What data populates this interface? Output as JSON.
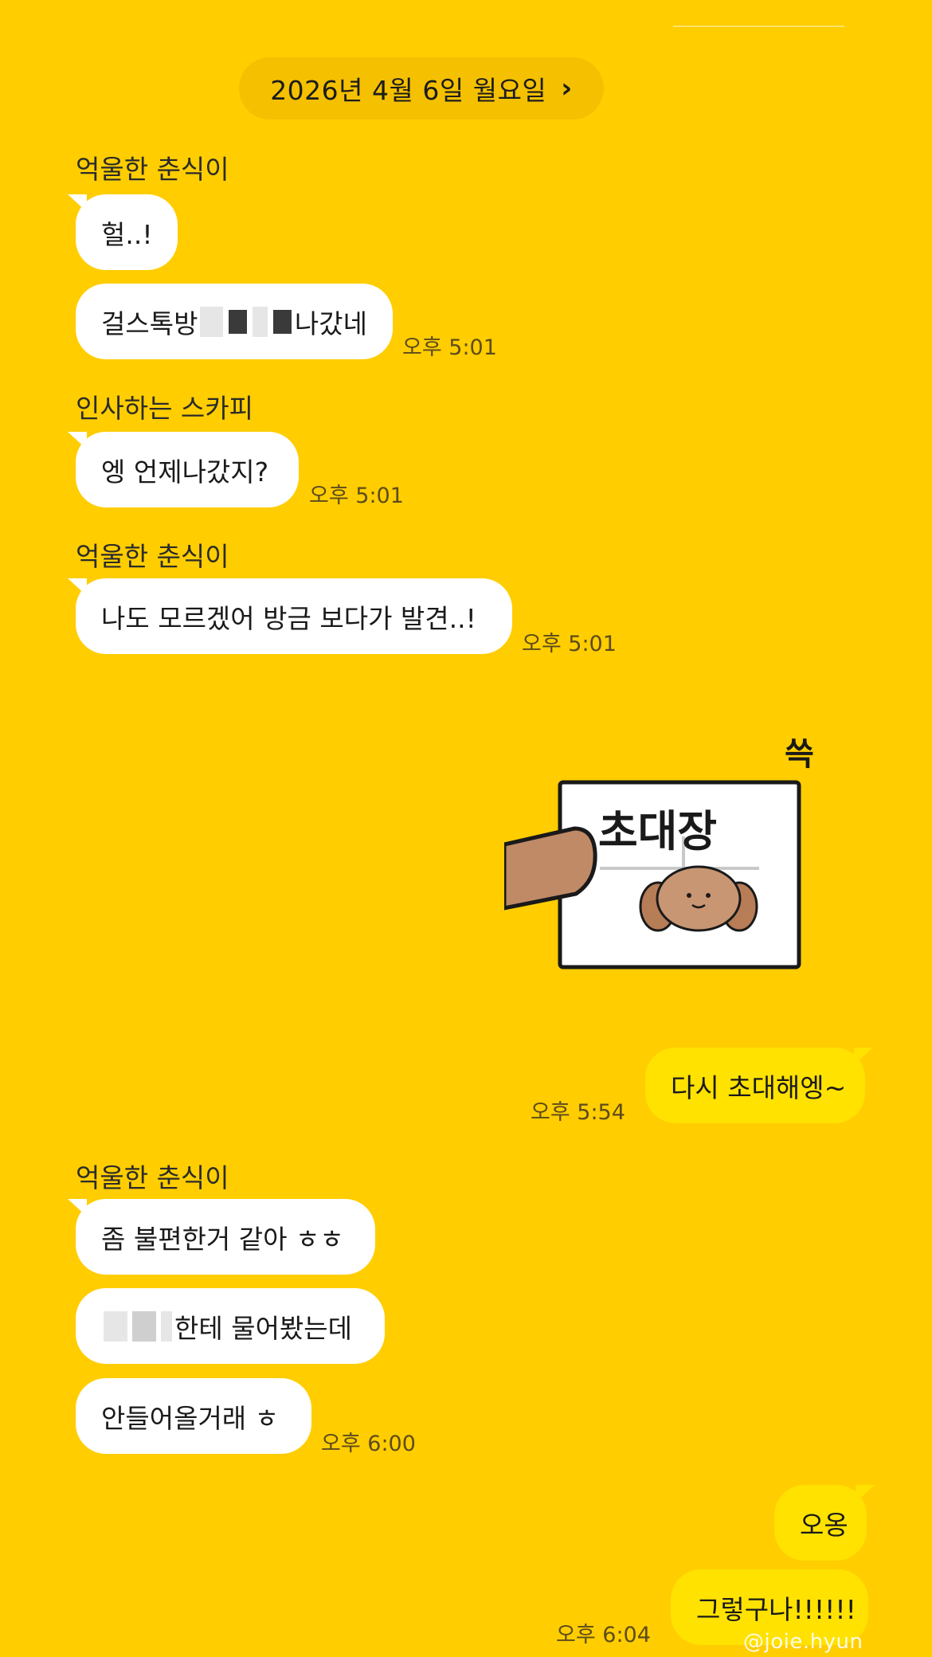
{
  "chat": {
    "date_label": "2026년 4월 6일 월요일",
    "date_chevron": "›",
    "groups": [
      {
        "sender": "억울한 춘식이",
        "messages": [
          "헐..!",
          "걸스톡방",
          "나갔네"
        ],
        "time": "오후 5:01"
      },
      {
        "sender": "인사하는 스카피",
        "messages": [
          "엥 언제나갔지?"
        ],
        "time": "오후 5:01"
      },
      {
        "sender": "억울한 춘식이",
        "messages": [
          "나도 모르겠어 방금 보다가 발견..!"
        ],
        "time": "오후 5:01"
      },
      {
        "sticker_text": "초대장",
        "sticker_corner_text": "쓱"
      },
      {
        "messages": [
          "다시 초대해엥~"
        ],
        "time": "오후 5:54"
      },
      {
        "sender": "억울한 춘식이",
        "messages": [
          "좀 불편한거 같아 ㅎㅎ",
          "한테 물어봤는데",
          "안들어올거래 ㅎ"
        ],
        "time": "오후 6:00"
      },
      {
        "messages": [
          "오옹",
          "그렇구나!!!!!!"
        ],
        "time": "오후 6:04"
      }
    ],
    "watermark": "@joie.hyun"
  },
  "colors": {
    "background": "#FFCD00",
    "bubble_theirs": "#FFFFFF",
    "bubble_mine": "#FFE200"
  },
  "icons": {
    "date_chevron": "chevron-right-icon",
    "sticker": "puppy-invitation-sticker"
  }
}
